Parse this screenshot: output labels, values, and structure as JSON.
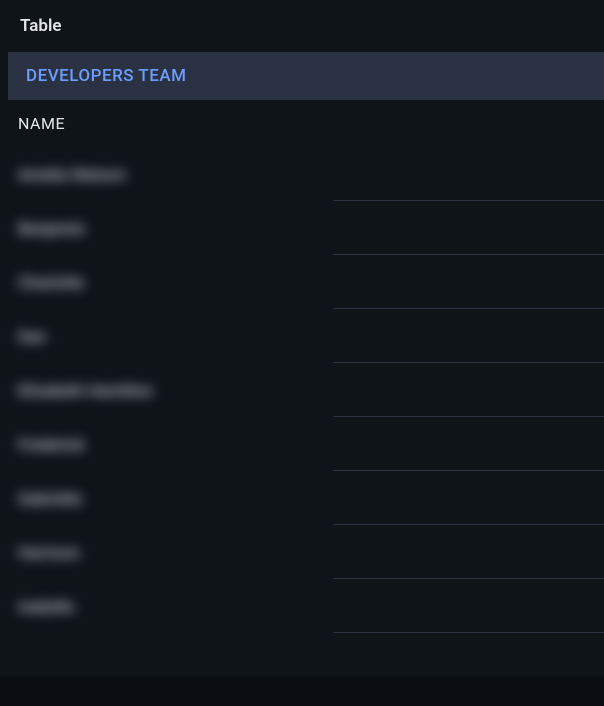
{
  "header": {
    "title": "Table"
  },
  "section": {
    "title": "DEVELOPERS TEAM"
  },
  "columns": {
    "name": "NAME"
  },
  "rows": [
    {
      "name_placeholder": "Amelia Watson"
    },
    {
      "name_placeholder": "Benjamin"
    },
    {
      "name_placeholder": "Charlotte"
    },
    {
      "name_placeholder": "Dan"
    },
    {
      "name_placeholder": "Elizabeth Hamilton"
    },
    {
      "name_placeholder": "Frederick"
    },
    {
      "name_placeholder": "Gabriella"
    },
    {
      "name_placeholder": "Harrison"
    },
    {
      "name_placeholder": "Isabella"
    }
  ]
}
